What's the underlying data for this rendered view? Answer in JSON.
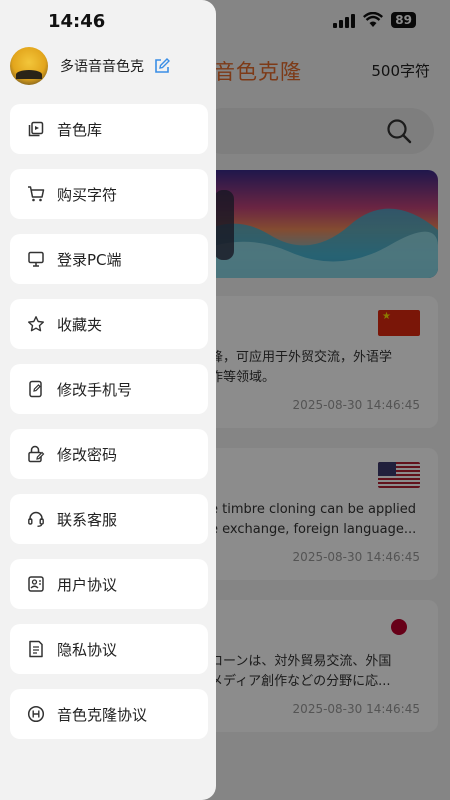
{
  "status_bar": {
    "time": "14:46",
    "battery": "89"
  },
  "background_app": {
    "title": "音色克隆",
    "char_count": "500字符",
    "cards": [
      {
        "flag": "china-flag",
        "desc": "锋，可应用于外贸交流，外语学\n作等领域。",
        "time": "2025-08-30 14:46:45"
      },
      {
        "flag": "us-flag",
        "desc": "e timbre cloning can be applied\ne exchange, foreign language...",
        "time": "2025-08-30 14:46:45"
      },
      {
        "flag": "japan-flag",
        "desc": "ローンは、対外貿易交流、外国\nメディア創作などの分野に応...",
        "time": "2025-08-30 14:46:45"
      }
    ]
  },
  "drawer": {
    "profile_name": "多语音音色克",
    "menu": [
      {
        "label": "音色库",
        "icon": "voice-library-icon"
      },
      {
        "label": "购买字符",
        "icon": "cart-icon"
      },
      {
        "label": "登录PC端",
        "icon": "monitor-icon"
      },
      {
        "label": "收藏夹",
        "icon": "star-icon"
      },
      {
        "label": "修改手机号",
        "icon": "phone-edit-icon"
      },
      {
        "label": "修改密码",
        "icon": "lock-edit-icon"
      },
      {
        "label": "联系客服",
        "icon": "headset-icon"
      },
      {
        "label": "用户协议",
        "icon": "user-agreement-icon"
      },
      {
        "label": "隐私协议",
        "icon": "privacy-doc-icon"
      },
      {
        "label": "音色克隆协议",
        "icon": "clone-agreement-icon"
      }
    ]
  },
  "colors": {
    "accent": "#e36a2a",
    "edit_icon": "#3a8ee6",
    "drawer_bg": "#f2f2f2",
    "item_bg": "#ffffff"
  }
}
